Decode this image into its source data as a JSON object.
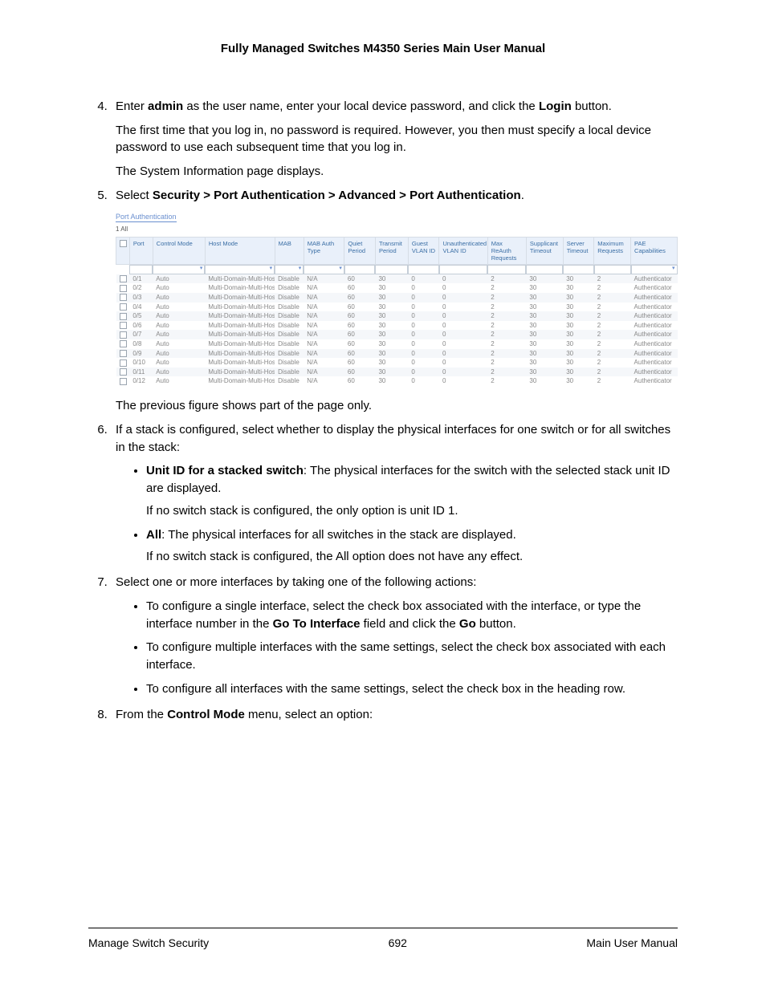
{
  "doc_title": "Fully Managed Switches M4350 Series Main User Manual",
  "steps": {
    "s4": {
      "p1a": "Enter ",
      "admin": "admin",
      "p1b": " as the user name, enter your local device password, and click the ",
      "login": "Login",
      "p1c": " button.",
      "p2": "The first time that you log in, no password is required. However, you then must specify a local device password to use each subsequent time that you log in.",
      "p3": "The System Information page displays."
    },
    "s5": {
      "lead": "Select ",
      "path": "Security > Port Authentication > Advanced > Port Authentication",
      "trail": "."
    },
    "fig_caption": "The previous figure shows part of the page only.",
    "s6": "If a stack is configured, select whether to display the physical interfaces for one switch or for all switches in the stack:",
    "b6": {
      "i1_label": "Unit ID for a stacked switch",
      "i1_rest": ": The physical interfaces for the switch with the selected stack unit ID are displayed.",
      "i1_p2": "If no switch stack is configured, the only option is unit ID 1.",
      "i2_label": "All",
      "i2_rest": ": The physical interfaces for all switches in the stack are displayed.",
      "i2_p2": "If no switch stack is configured, the All option does not have any effect."
    },
    "s7": "Select one or more interfaces by taking one of the following actions:",
    "b7": {
      "i1a": "To configure a single interface, select the check box associated with the interface, or type the interface number in the ",
      "goto": "Go To Interface",
      "i1b": " field and click the ",
      "go": "Go",
      "i1c": " button.",
      "i2": "To configure multiple interfaces with the same settings, select the check box associated with each interface.",
      "i3": "To configure all interfaces with the same settings, select the check box in the heading row."
    },
    "s8a": "From the ",
    "s8b": "Control Mode",
    "s8c": " menu, select an option:"
  },
  "fig": {
    "title": "Port Authentication",
    "tabs": "1 All",
    "headers": [
      "",
      "Port",
      "Control Mode",
      "Host Mode",
      "MAB",
      "MAB Auth Type",
      "Quiet Period",
      "Transmit Period",
      "Guest VLAN ID",
      "Unauthenticated VLAN ID",
      "Max ReAuth Requests",
      "Supplicant Timeout",
      "Server Timeout",
      "Maximum Requests",
      "PAE Capabilities"
    ],
    "rows": [
      {
        "port": "0/1",
        "cm": "Auto",
        "hm": "Multi-Domain-Multi-Host",
        "mab": "Disable",
        "mat": "N/A",
        "qp": "60",
        "tp": "30",
        "gv": "0",
        "uv": "0",
        "mr": "2",
        "st": "30",
        "srt": "30",
        "mreq": "2",
        "pae": "Authenticator"
      },
      {
        "port": "0/2",
        "cm": "Auto",
        "hm": "Multi-Domain-Multi-Host",
        "mab": "Disable",
        "mat": "N/A",
        "qp": "60",
        "tp": "30",
        "gv": "0",
        "uv": "0",
        "mr": "2",
        "st": "30",
        "srt": "30",
        "mreq": "2",
        "pae": "Authenticator"
      },
      {
        "port": "0/3",
        "cm": "Auto",
        "hm": "Multi-Domain-Multi-Host",
        "mab": "Disable",
        "mat": "N/A",
        "qp": "60",
        "tp": "30",
        "gv": "0",
        "uv": "0",
        "mr": "2",
        "st": "30",
        "srt": "30",
        "mreq": "2",
        "pae": "Authenticator"
      },
      {
        "port": "0/4",
        "cm": "Auto",
        "hm": "Multi-Domain-Multi-Host",
        "mab": "Disable",
        "mat": "N/A",
        "qp": "60",
        "tp": "30",
        "gv": "0",
        "uv": "0",
        "mr": "2",
        "st": "30",
        "srt": "30",
        "mreq": "2",
        "pae": "Authenticator"
      },
      {
        "port": "0/5",
        "cm": "Auto",
        "hm": "Multi-Domain-Multi-Host",
        "mab": "Disable",
        "mat": "N/A",
        "qp": "60",
        "tp": "30",
        "gv": "0",
        "uv": "0",
        "mr": "2",
        "st": "30",
        "srt": "30",
        "mreq": "2",
        "pae": "Authenticator"
      },
      {
        "port": "0/6",
        "cm": "Auto",
        "hm": "Multi-Domain-Multi-Host",
        "mab": "Disable",
        "mat": "N/A",
        "qp": "60",
        "tp": "30",
        "gv": "0",
        "uv": "0",
        "mr": "2",
        "st": "30",
        "srt": "30",
        "mreq": "2",
        "pae": "Authenticator"
      },
      {
        "port": "0/7",
        "cm": "Auto",
        "hm": "Multi-Domain-Multi-Host",
        "mab": "Disable",
        "mat": "N/A",
        "qp": "60",
        "tp": "30",
        "gv": "0",
        "uv": "0",
        "mr": "2",
        "st": "30",
        "srt": "30",
        "mreq": "2",
        "pae": "Authenticator"
      },
      {
        "port": "0/8",
        "cm": "Auto",
        "hm": "Multi-Domain-Multi-Host",
        "mab": "Disable",
        "mat": "N/A",
        "qp": "60",
        "tp": "30",
        "gv": "0",
        "uv": "0",
        "mr": "2",
        "st": "30",
        "srt": "30",
        "mreq": "2",
        "pae": "Authenticator"
      },
      {
        "port": "0/9",
        "cm": "Auto",
        "hm": "Multi-Domain-Multi-Host",
        "mab": "Disable",
        "mat": "N/A",
        "qp": "60",
        "tp": "30",
        "gv": "0",
        "uv": "0",
        "mr": "2",
        "st": "30",
        "srt": "30",
        "mreq": "2",
        "pae": "Authenticator"
      },
      {
        "port": "0/10",
        "cm": "Auto",
        "hm": "Multi-Domain-Multi-Host",
        "mab": "Disable",
        "mat": "N/A",
        "qp": "60",
        "tp": "30",
        "gv": "0",
        "uv": "0",
        "mr": "2",
        "st": "30",
        "srt": "30",
        "mreq": "2",
        "pae": "Authenticator"
      },
      {
        "port": "0/11",
        "cm": "Auto",
        "hm": "Multi-Domain-Multi-Host",
        "mab": "Disable",
        "mat": "N/A",
        "qp": "60",
        "tp": "30",
        "gv": "0",
        "uv": "0",
        "mr": "2",
        "st": "30",
        "srt": "30",
        "mreq": "2",
        "pae": "Authenticator"
      },
      {
        "port": "0/12",
        "cm": "Auto",
        "hm": "Multi-Domain-Multi-Host",
        "mab": "Disable",
        "mat": "N/A",
        "qp": "60",
        "tp": "30",
        "gv": "0",
        "uv": "0",
        "mr": "2",
        "st": "30",
        "srt": "30",
        "mreq": "2",
        "pae": "Authenticator"
      }
    ]
  },
  "footer": {
    "left": "Manage Switch Security",
    "center": "692",
    "right": "Main User Manual"
  }
}
